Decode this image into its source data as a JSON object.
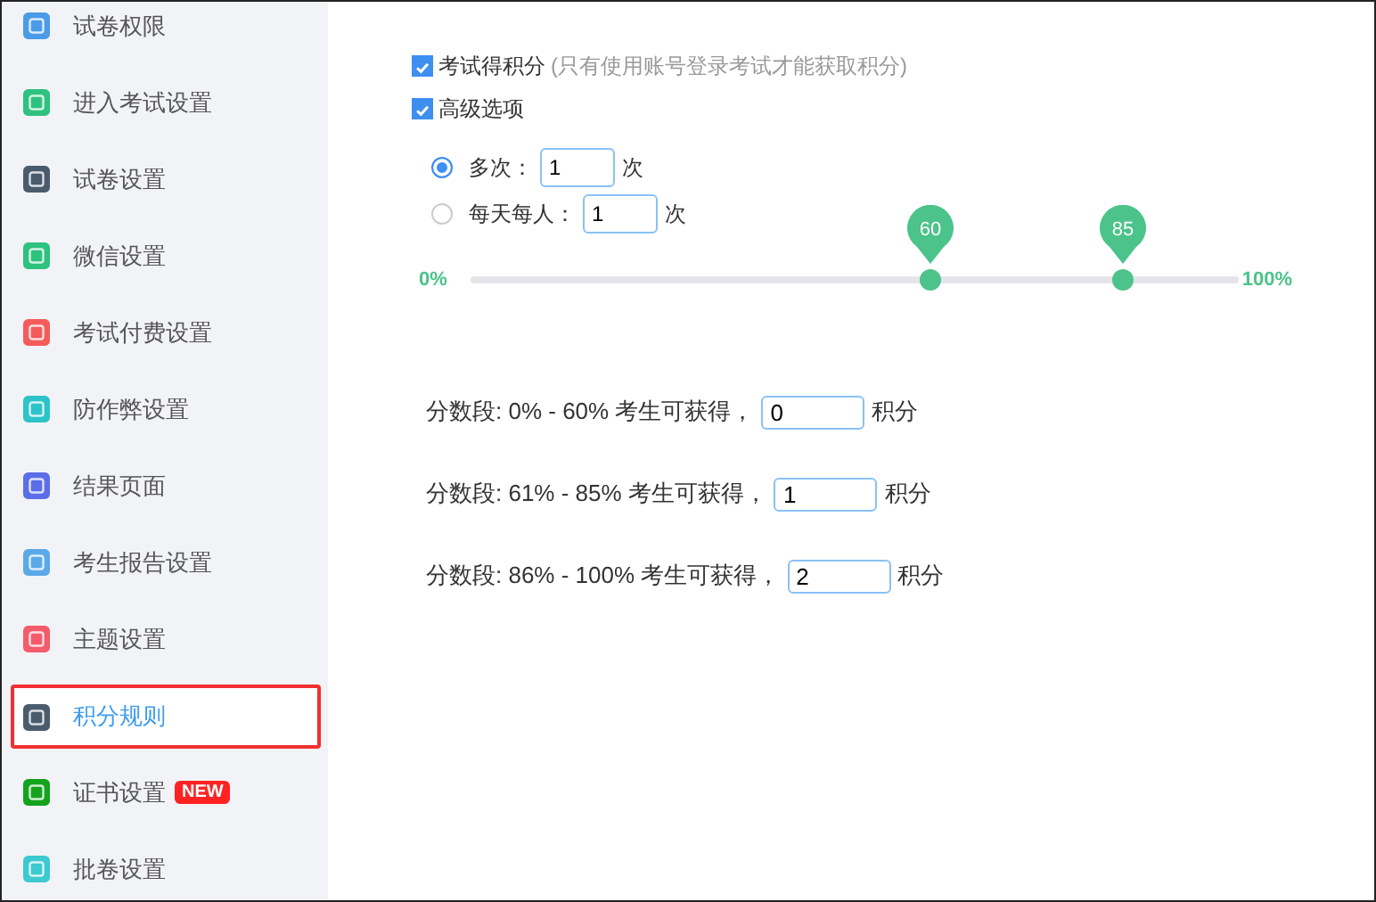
{
  "sidebar": {
    "items": [
      {
        "label": "试卷权限",
        "color": "#4a9be8",
        "selected": false
      },
      {
        "label": "进入考试设置",
        "color": "#2ec27e",
        "selected": false
      },
      {
        "label": "试卷设置",
        "color": "#4b5b6e",
        "selected": false
      },
      {
        "label": "微信设置",
        "color": "#2ec27e",
        "selected": false
      },
      {
        "label": "考试付费设置",
        "color": "#f45b5b",
        "selected": false
      },
      {
        "label": "防作弊设置",
        "color": "#2cc3c9",
        "selected": false
      },
      {
        "label": "结果页面",
        "color": "#5b6ee8",
        "selected": false
      },
      {
        "label": "考生报告设置",
        "color": "#5aa9e8",
        "selected": false
      },
      {
        "label": "主题设置",
        "color": "#f45b6b",
        "selected": false
      },
      {
        "label": "积分规则",
        "color": "#4b5b6e",
        "selected": true
      },
      {
        "label": "证书设置",
        "color": "#14a31c",
        "selected": false,
        "badge": "NEW"
      },
      {
        "label": "批卷设置",
        "color": "#3cc9d0",
        "selected": false
      }
    ]
  },
  "options": [
    {
      "label": "考试得积分",
      "note": "(只有使用账号登录考试才能获取积分)",
      "checked": true
    },
    {
      "label": "高级选项",
      "checked": true
    }
  ],
  "frequency": [
    {
      "label": "多次：",
      "value": "1",
      "unit": "次",
      "selected": true
    },
    {
      "label": "每天每人：",
      "value": "1",
      "unit": "次",
      "selected": false
    }
  ],
  "slider": {
    "min_label": "0%",
    "max_label": "100%",
    "handles": [
      {
        "label": "60",
        "level": 0.6
      },
      {
        "label": "85",
        "level": 0.85
      }
    ]
  },
  "ranges": [
    {
      "text": "分数段: 0% - 60% 考生可获得，",
      "value": "0",
      "unit": "积分"
    },
    {
      "text": "分数段: 61% - 85% 考生可获得，",
      "value": "1",
      "unit": "积分"
    },
    {
      "text": "分数段: 86% - 100% 考生可获得，",
      "value": "2",
      "unit": "积分"
    }
  ]
}
